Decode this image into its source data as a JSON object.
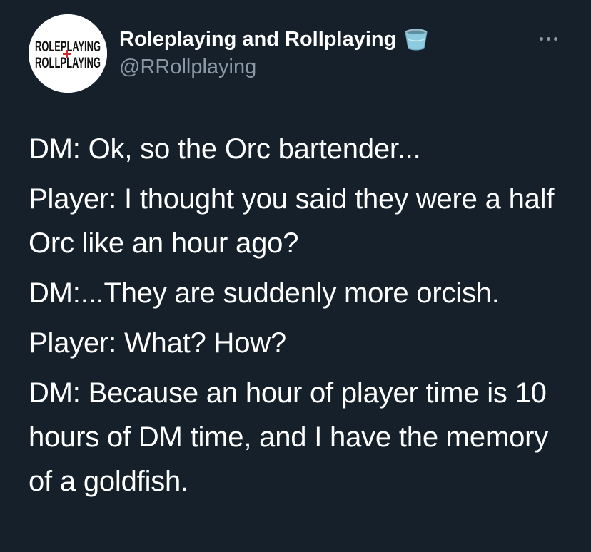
{
  "author": {
    "display_name": "Roleplaying and Rollplaying",
    "handle": "@RRollplaying",
    "avatar_text": [
      "ROLEPLAYING",
      "ROLLPLAYING"
    ],
    "badge_icon": "bucket-icon",
    "avatar_accent_color": "#d62828"
  },
  "more_icon": "more-horizontal-icon",
  "tweet": {
    "paragraphs": [
      "DM: Ok, so the Orc bartender...",
      "Player: I thought you said they were a half Orc like an hour ago?",
      "DM:...They are suddenly more orcish.",
      "Player: What? How?",
      "DM: Because an hour of player time is 10 hours of DM time, and I have the memory of a goldfish."
    ]
  },
  "theme": {
    "background": "#15202b",
    "text": "#ffffff",
    "secondary_text": "#8b98a5"
  }
}
